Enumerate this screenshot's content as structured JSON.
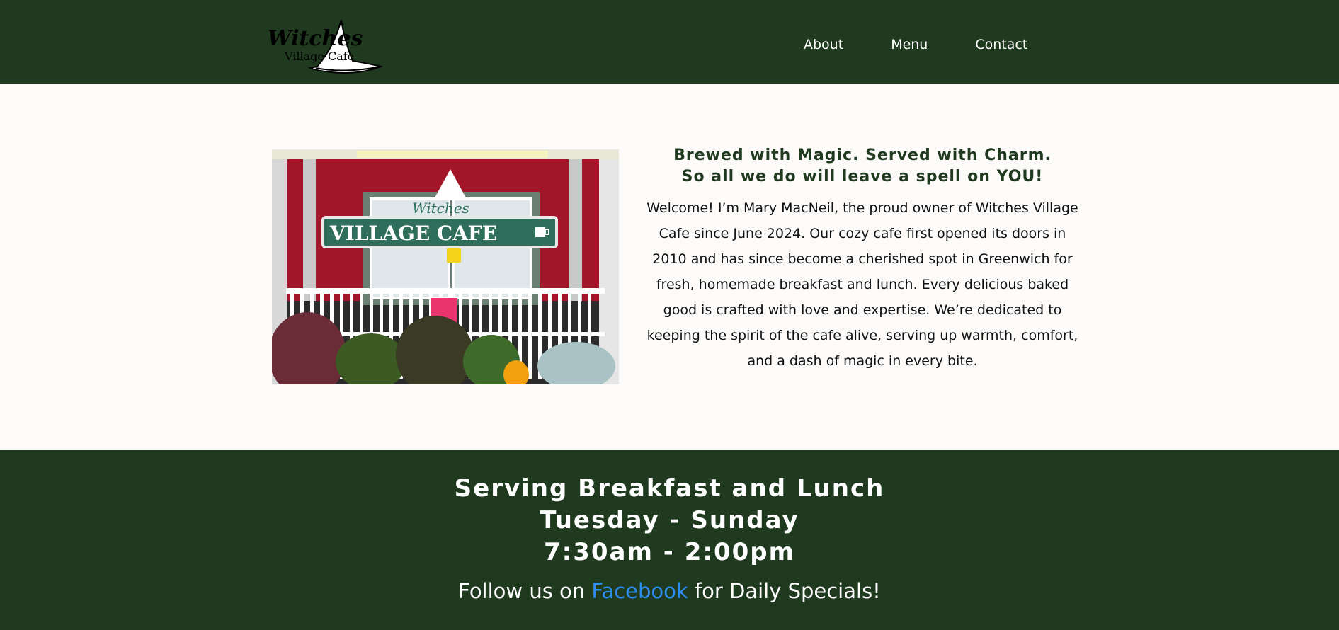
{
  "header": {
    "logo": {
      "line1": "Witches",
      "line2": "Village Cafe",
      "icon": "witch-hat-icon"
    },
    "nav": [
      {
        "label": "About"
      },
      {
        "label": "Menu"
      },
      {
        "label": "Contact"
      }
    ]
  },
  "hero_image": {
    "sign_small": "Witches",
    "sign_text": "VILLAGE CAFE",
    "icon": "coffee-cup-icon"
  },
  "intro": {
    "tagline_1": "Brewed with Magic. Served with Charm.",
    "tagline_2": "So all we do will leave a spell on YOU!",
    "welcome": "Welcome! I’m Mary MacNeil, the proud owner of Witches Village Cafe since June 2024. Our cozy cafe first opened its doors in 2010 and has since become a cherished spot in Greenwich for fresh, homemade breakfast and lunch. Every delicious baked good is crafted with love and expertise. We’re dedicated to keeping the spirit of the cafe alive, serving up warmth, comfort, and a dash of magic in every bite."
  },
  "hours": {
    "line1": "Serving Breakfast and Lunch",
    "line2": "Tuesday - Sunday",
    "line3": "7:30am - 2:00pm"
  },
  "follow": {
    "prefix": "Follow us on ",
    "link": "Facebook",
    "suffix": " for Daily Specials!"
  },
  "colors": {
    "brand_green": "#1f3a1f",
    "link_blue": "#2d8cf0",
    "background": "#fcfbfa"
  }
}
